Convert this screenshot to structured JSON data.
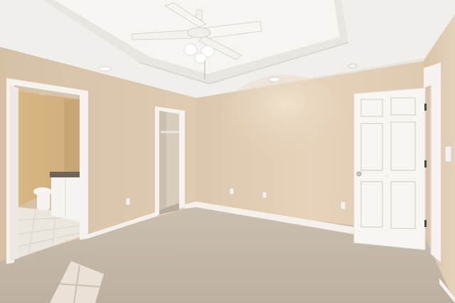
{
  "scene": {
    "kind": "photo",
    "subject": "empty-bedroom-interior",
    "colors": {
      "ceiling": "#f2f0ec",
      "tray_ceiling": "#f6f5f2",
      "wall_left": "#dcc7ad",
      "wall_back": "#e3cfb5",
      "wall_right": "#ddc8ac",
      "carpet": "#c4b7a6",
      "baseboard": "#f4f1ec",
      "door": "#f7f6f3",
      "trim": "#f5f3ef",
      "bath_wall": "#d8b889",
      "bath_floor": "#ece7df",
      "closet_wall": "#d6cbbd"
    },
    "icons": [
      "ceiling-fan-icon",
      "recessed-light-icon",
      "door-handle-icon",
      "outlet-icon",
      "light-switch-icon"
    ]
  }
}
